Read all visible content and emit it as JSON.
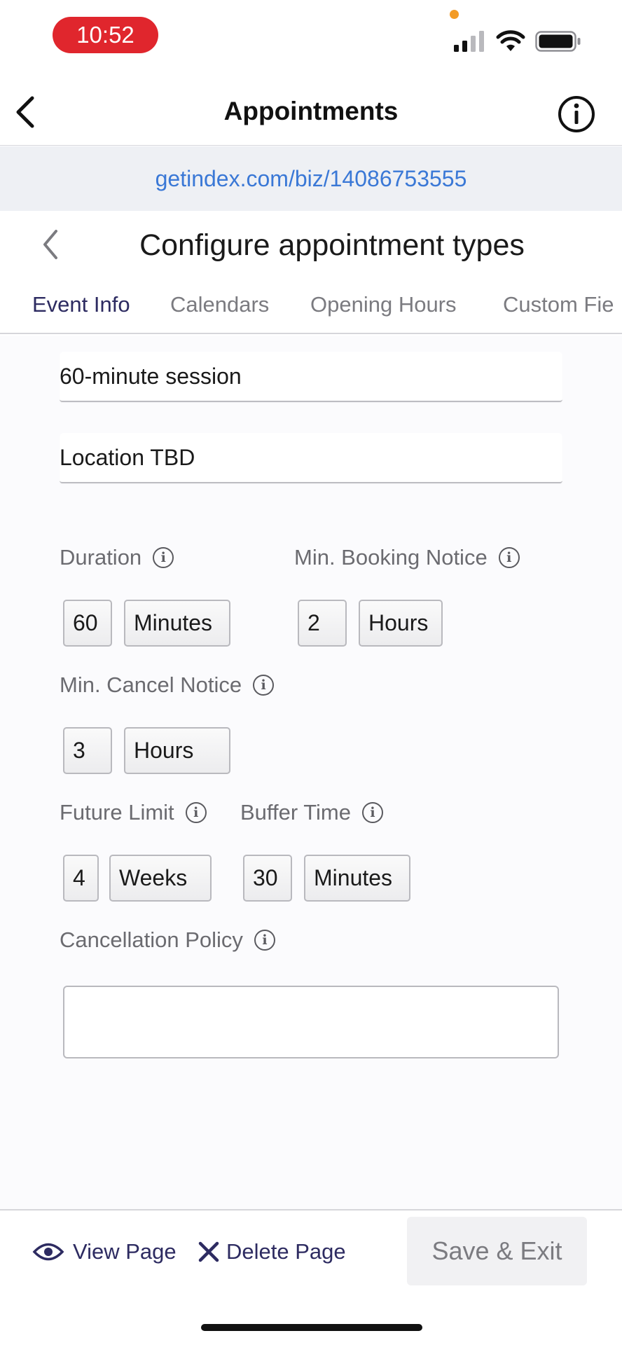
{
  "status_bar": {
    "time": "10:52"
  },
  "header": {
    "title": "Appointments"
  },
  "url_bar": {
    "url": "getindex.com/biz/14086753555"
  },
  "page": {
    "title": "Configure appointment types",
    "tabs": [
      {
        "label": "Event Info"
      },
      {
        "label": "Calendars"
      },
      {
        "label": "Opening Hours"
      },
      {
        "label": "Custom Fie"
      }
    ]
  },
  "form": {
    "name": "60-minute session",
    "location": "Location TBD",
    "duration": {
      "label": "Duration",
      "value": "60",
      "unit": "Minutes"
    },
    "min_booking_notice": {
      "label": "Min. Booking Notice",
      "value": "2",
      "unit": "Hours"
    },
    "min_cancel_notice": {
      "label": "Min. Cancel Notice",
      "value": "3",
      "unit": "Hours"
    },
    "future_limit": {
      "label": "Future Limit",
      "value": "4",
      "unit": "Weeks"
    },
    "buffer_time": {
      "label": "Buffer Time",
      "value": "30",
      "unit": "Minutes"
    },
    "cancellation_policy": {
      "label": "Cancellation Policy",
      "value": ""
    }
  },
  "bottom_bar": {
    "view_page": "View Page",
    "delete_page": "Delete Page",
    "save_exit": "Save & Exit"
  },
  "colors": {
    "accent": "#2d2b61",
    "link": "#3a78d6",
    "time_pill": "#e0262d",
    "orange_dot": "#f39b25"
  }
}
